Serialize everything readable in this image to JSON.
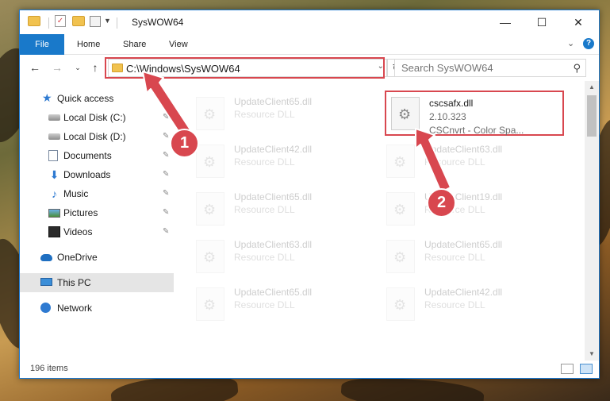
{
  "window": {
    "title": "SysWOW64"
  },
  "ribbon": {
    "tabs": [
      "File",
      "Home",
      "Share",
      "View"
    ],
    "help": "?"
  },
  "navigation": {
    "address_path": "C:\\Windows\\SysWOW64",
    "search_placeholder": "Search SysWOW64"
  },
  "sidebar": {
    "items": [
      {
        "label": "Quick access",
        "icon": "star-icon"
      },
      {
        "label": "Local Disk (C:)",
        "icon": "drive-icon",
        "pinned": true
      },
      {
        "label": "Local Disk (D:)",
        "icon": "drive-icon",
        "pinned": true
      },
      {
        "label": "Documents",
        "icon": "documents-icon",
        "pinned": true
      },
      {
        "label": "Downloads",
        "icon": "downloads-icon",
        "pinned": true
      },
      {
        "label": "Music",
        "icon": "music-icon",
        "pinned": true
      },
      {
        "label": "Pictures",
        "icon": "pictures-icon",
        "pinned": true
      },
      {
        "label": "Videos",
        "icon": "videos-icon",
        "pinned": true
      },
      {
        "label": "OneDrive",
        "icon": "onedrive-icon"
      },
      {
        "label": "This PC",
        "icon": "this-pc-icon",
        "selected": true
      },
      {
        "label": "Network",
        "icon": "network-icon"
      }
    ]
  },
  "files": [
    {
      "name": "UpdateClient65.dll",
      "type": "Resource DLL"
    },
    {
      "name": "cscsafx.dll",
      "type": "2.10.323",
      "description": "CSCnvrt - Color Spa...",
      "highlighted": true
    },
    {
      "name": "UpdateClient42.dll",
      "type": "Resource DLL"
    },
    {
      "name": "UpdateClient63.dll",
      "type": "Resource DLL"
    },
    {
      "name": "UpdateClient65.dll",
      "type": "Resource DLL"
    },
    {
      "name": "UpdateClient19.dll",
      "type": "Resource DLL"
    },
    {
      "name": "UpdateClient63.dll",
      "type": "Resource DLL"
    },
    {
      "name": "UpdateClient65.dll",
      "type": "Resource DLL"
    },
    {
      "name": "UpdateClient65.dll",
      "type": "Resource DLL"
    },
    {
      "name": "UpdateClient42.dll",
      "type": "Resource DLL"
    }
  ],
  "statusbar": {
    "item_count": "196 items"
  },
  "annotations": {
    "step1": "1",
    "step2": "2",
    "color": "#d8474f"
  },
  "colors": {
    "accent": "#1979ca",
    "highlight": "#d8474f",
    "selected_bg": "#e5e5e5"
  }
}
